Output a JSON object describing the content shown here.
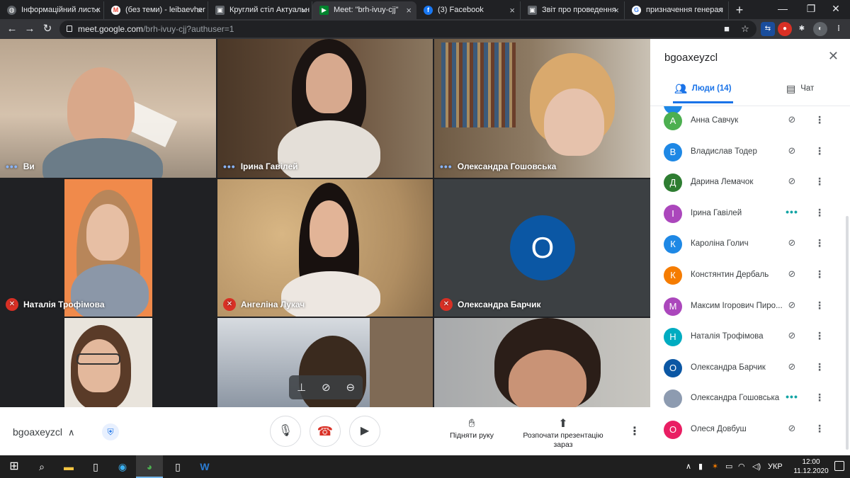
{
  "browser": {
    "tabs": [
      {
        "title": "Інформаційний лист к",
        "icon": "globe-icon",
        "color": "#5f6368"
      },
      {
        "title": "(без теми) - leibaevher",
        "icon": "gmail-icon",
        "color": "#ea4335"
      },
      {
        "title": "Круглий стіл Актуальн",
        "icon": "image-icon",
        "color": "#5f6368"
      },
      {
        "title": "Meet: \"brh-ivuy-cjj\"",
        "icon": "meet-icon",
        "color": "#00832d",
        "active": true
      },
      {
        "title": "(3) Facebook",
        "icon": "facebook-icon",
        "color": "#1877f2"
      },
      {
        "title": "Звіт про проведення",
        "icon": "image-icon",
        "color": "#5f6368"
      },
      {
        "title": "призначення генерал",
        "icon": "google-icon",
        "color": "#4285f4"
      }
    ],
    "new_tab": "+",
    "url_host": "meet.google.com",
    "url_path": "/brh-ivuy-cjj?authuser=1"
  },
  "tiles": [
    {
      "name": "Ви",
      "status": "speaking"
    },
    {
      "name": "Ірина Гавілей",
      "status": "speaking"
    },
    {
      "name": "Олександра Гошовська",
      "status": "speaking"
    },
    {
      "name": "Наталія Трофімова",
      "status": "muted"
    },
    {
      "name": "Ангеліна Лукач",
      "status": "muted"
    },
    {
      "name": "Олександра Барчик",
      "status": "muted",
      "avatar_letter": "О"
    }
  ],
  "bottom": {
    "meeting_code": "bgoaxeyzcl",
    "raise_hand": "Підняти руку",
    "present_line1": "Розпочати презентацію",
    "present_line2": "зараз"
  },
  "panel": {
    "title": "bgoaxeyzcl",
    "tab_people": "Люди (14)",
    "tab_chat": "Чат",
    "participants": [
      {
        "initial": "А",
        "name": "Анна Савчук",
        "color": "#4caf50",
        "status": "muted"
      },
      {
        "initial": "В",
        "name": "Владислав Тодер",
        "color": "#1e88e5",
        "status": "muted"
      },
      {
        "initial": "Д",
        "name": "Дарина Лемачок",
        "color": "#2e7d32",
        "status": "muted"
      },
      {
        "initial": "І",
        "name": "Ірина Гавілей",
        "color": "#ab47bc",
        "status": "speaking"
      },
      {
        "initial": "К",
        "name": "Кароліна Голич",
        "color": "#1e88e5",
        "status": "muted"
      },
      {
        "initial": "К",
        "name": "Констянтин Дербаль",
        "color": "#f57c00",
        "status": "muted"
      },
      {
        "initial": "М",
        "name": "Максим Ігорович Пиро...",
        "color": "#ab47bc",
        "status": "muted"
      },
      {
        "initial": "Н",
        "name": "Наталія Трофімова",
        "color": "#00acc1",
        "status": "muted"
      },
      {
        "initial": "О",
        "name": "Олександра Барчик",
        "color": "#0b57a4",
        "status": "muted"
      },
      {
        "initial": "",
        "name": "Олександра Гошовська",
        "color": "#8d9bb0",
        "status": "speaking"
      },
      {
        "initial": "О",
        "name": "Олеся Довбуш",
        "color": "#e91e63",
        "status": "muted"
      }
    ]
  },
  "taskbar": {
    "lang": "УКР",
    "time": "12:00",
    "date": "11.12.2020"
  }
}
